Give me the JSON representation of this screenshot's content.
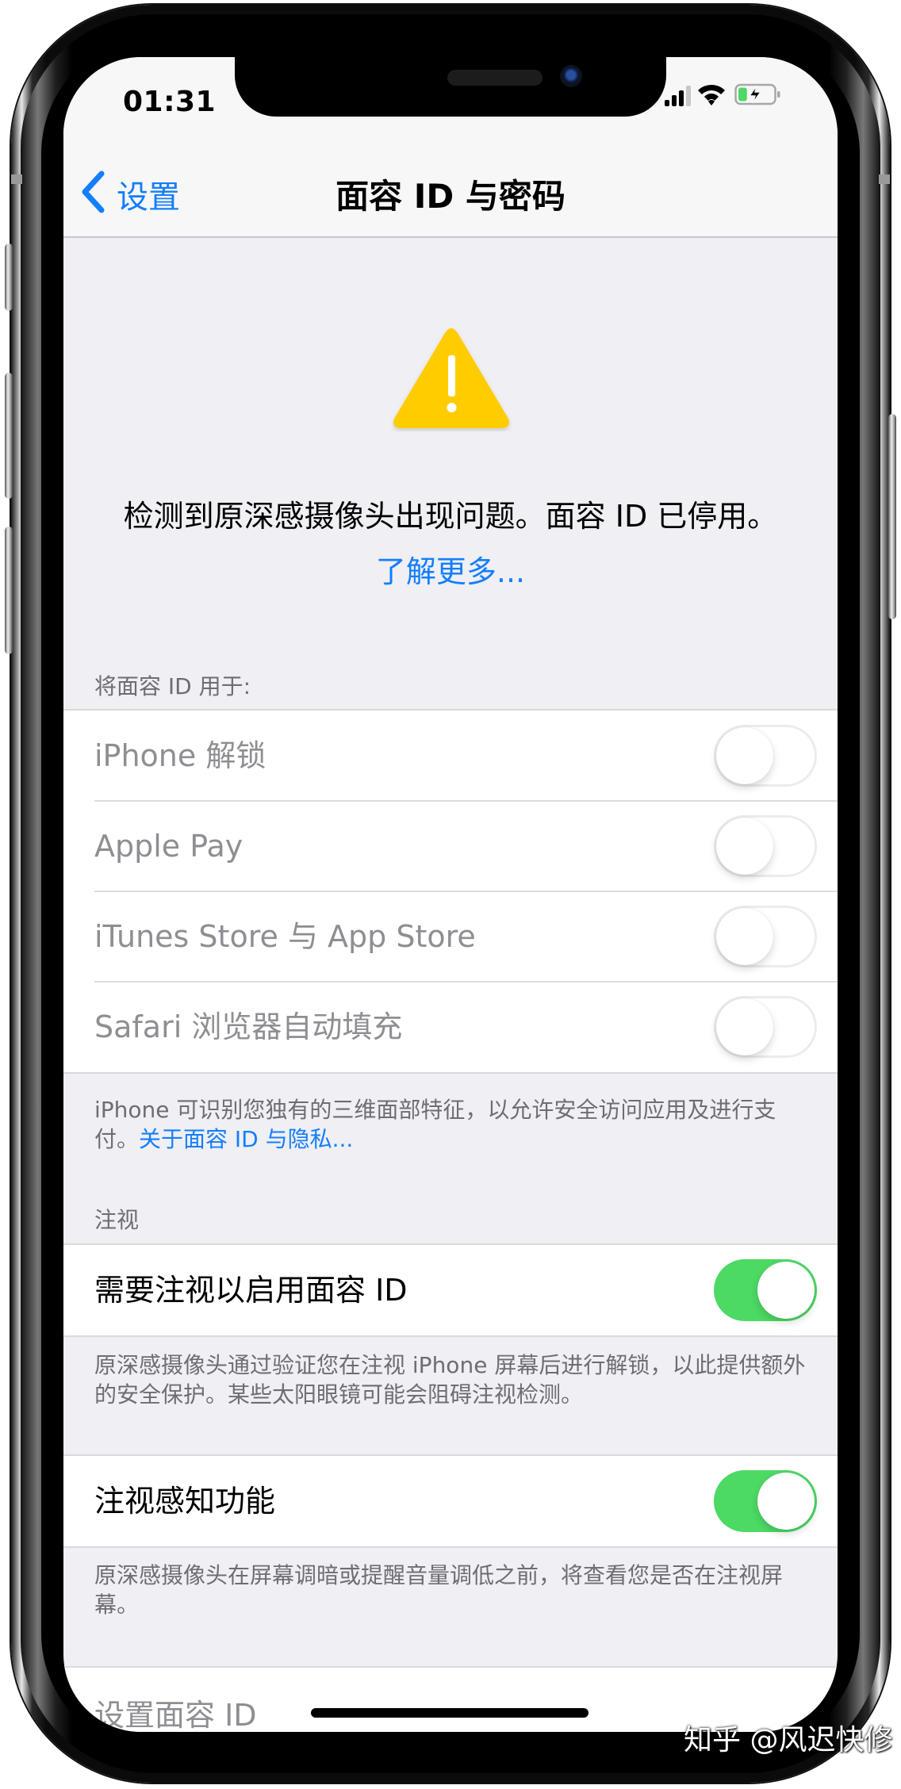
{
  "status_bar": {
    "time": "01:31",
    "signal_bars": 3,
    "signal_bars_total": 4,
    "wifi": "wifi-icon",
    "battery": {
      "icon": "battery-charging-icon",
      "charging": true,
      "level_fraction": 0.25,
      "fill_color": "#4cd964"
    }
  },
  "nav": {
    "back_label": "设置",
    "title": "面容 ID 与密码"
  },
  "warning": {
    "icon": "warning-triangle-icon",
    "icon_color": "#ffcc00",
    "message": "检测到原深感摄像头出现问题。面容 ID 已停用。",
    "learn_more": "了解更多..."
  },
  "use_face_id": {
    "header": "将面容 ID 用于:",
    "items": [
      {
        "label": "iPhone 解锁",
        "on": false,
        "enabled": false
      },
      {
        "label": "Apple Pay",
        "on": false,
        "enabled": false
      },
      {
        "label": "iTunes Store 与 App Store",
        "on": false,
        "enabled": false
      },
      {
        "label": "Safari 浏览器自动填充",
        "on": false,
        "enabled": false
      }
    ],
    "footer_text": "iPhone 可识别您独有的三维面部特征，以允许安全访问应用及进行支付。",
    "footer_link": "关于面容 ID 与隐私..."
  },
  "attention": {
    "header": "注视",
    "require_attention": {
      "label": "需要注视以启用面容 ID",
      "on": true,
      "footer": "原深感摄像头通过验证您在注视 iPhone 屏幕后进行解锁，以此提供额外的安全保护。某些太阳眼镜可能会阻碍注视检测。"
    },
    "attention_aware": {
      "label": "注视感知功能",
      "on": true,
      "footer": "原深感摄像头在屏幕调暗或提醒音量调低之前，将查看您是否在注视屏幕。"
    }
  },
  "setup": {
    "label": "设置面容 ID"
  },
  "watermark": "知乎 @风迟快修",
  "colors": {
    "accent": "#147efb",
    "toggle_on": "#4cd964",
    "background": "#efeff4"
  }
}
